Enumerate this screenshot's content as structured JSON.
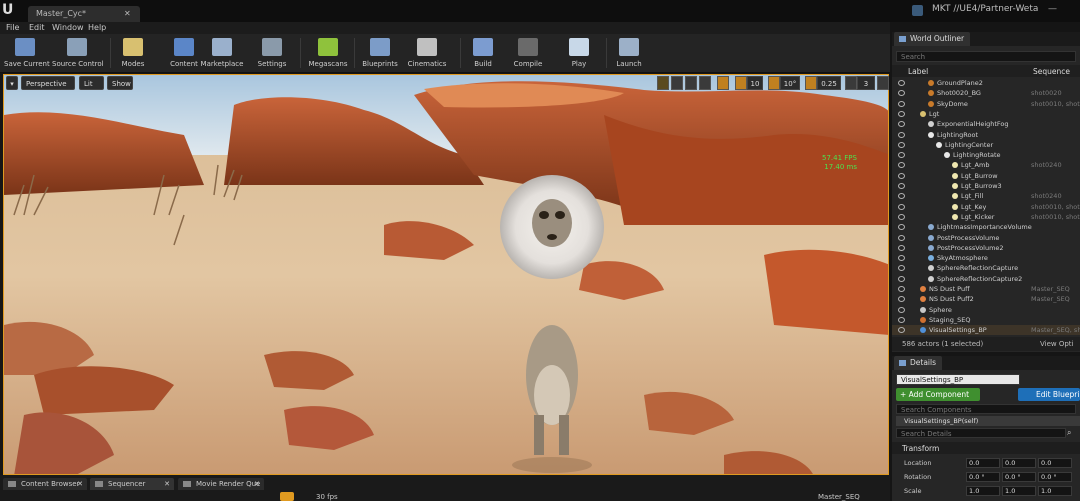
{
  "app": {
    "logo": "U",
    "document_tab": "Master_Cyc*",
    "project_title": "MKT //UE4/Partner-Weta"
  },
  "menu": [
    "File",
    "Edit",
    "Window",
    "Help"
  ],
  "toolbar": [
    {
      "label": "Save Current",
      "icon": "save-icon",
      "color": "#6b8fc4"
    },
    {
      "label": "Source Control",
      "icon": "source-control-icon",
      "color": "#8aa0b8"
    },
    {
      "label": "Modes",
      "icon": "modes-icon",
      "color": "#d8c070"
    },
    {
      "label": "Content",
      "icon": "content-icon",
      "color": "#5b86c8"
    },
    {
      "label": "Marketplace",
      "icon": "marketplace-icon",
      "color": "#9ab0cc"
    },
    {
      "label": "Settings",
      "icon": "settings-icon",
      "color": "#8a9aaa"
    },
    {
      "label": "Megascans",
      "icon": "megascans-icon",
      "color": "#8fc23c"
    },
    {
      "label": "Blueprints",
      "icon": "blueprints-icon",
      "color": "#7c9cc8"
    },
    {
      "label": "Cinematics",
      "icon": "cinematics-icon",
      "color": "#c0c0c0"
    },
    {
      "label": "Build",
      "icon": "build-icon",
      "color": "#7c9cd0"
    },
    {
      "label": "Compile",
      "icon": "compile-icon",
      "color": "#6a6a6a"
    },
    {
      "label": "Play",
      "icon": "play-icon",
      "color": "#c8d8e8"
    },
    {
      "label": "Launch",
      "icon": "launch-icon",
      "color": "#9cb0c8"
    }
  ],
  "viewport": {
    "perspective_label": "Perspective",
    "lit_label": "Lit",
    "show_label": "Show",
    "grid_snap": "10",
    "rotation_snap": "10°",
    "scale_snap": "0.25",
    "camera_speed": "3",
    "stats_fps": "57.41 FPS",
    "stats_ms": "17.40 ms"
  },
  "bottom_tabs": [
    {
      "label": "Content Browser"
    },
    {
      "label": "Sequencer"
    },
    {
      "label": "Movie Render Que"
    }
  ],
  "sequencer_toolbar": {
    "fps": "30 fps",
    "sequence_name": "Master_SEQ"
  },
  "outliner": {
    "tab_label": "World Outliner",
    "search_placeholder": "Search",
    "col_label": "Label",
    "col_sequence": "Sequence",
    "rows": [
      {
        "label": "GroundPlane2",
        "seq": "",
        "indent": 1,
        "color": "#c87a2a"
      },
      {
        "label": "Shot0020_BG",
        "seq": "shot0020",
        "indent": 1,
        "color": "#c87a2a"
      },
      {
        "label": "SkyDome",
        "seq": "shot0010, shot",
        "indent": 1,
        "color": "#c87a2a"
      },
      {
        "label": "Lgt",
        "seq": "",
        "indent": 0,
        "color": "#d8c070"
      },
      {
        "label": "ExponentialHeightFog",
        "seq": "",
        "indent": 1,
        "color": "#d0d0d0"
      },
      {
        "label": "LightingRoot",
        "seq": "",
        "indent": 1,
        "color": "#e8e8e8"
      },
      {
        "label": "LightingCenter",
        "seq": "",
        "indent": 2,
        "color": "#e8e8e8"
      },
      {
        "label": "LightingRotate",
        "seq": "",
        "indent": 3,
        "color": "#e8e8e8"
      },
      {
        "label": "Lgt_Amb",
        "seq": "shot0240",
        "indent": 4,
        "color": "#f0e8b0"
      },
      {
        "label": "Lgt_Burrow",
        "seq": "",
        "indent": 4,
        "color": "#f0e8b0"
      },
      {
        "label": "Lgt_Burrow3",
        "seq": "",
        "indent": 4,
        "color": "#f0e8b0"
      },
      {
        "label": "Lgt_Fill",
        "seq": "shot0240",
        "indent": 4,
        "color": "#f0e8b0"
      },
      {
        "label": "Lgt_Key",
        "seq": "shot0010, shot",
        "indent": 4,
        "color": "#f0e8b0"
      },
      {
        "label": "Lgt_Kicker",
        "seq": "shot0010, shot",
        "indent": 4,
        "color": "#f0e8b0"
      },
      {
        "label": "LightmassImportanceVolume",
        "seq": "",
        "indent": 1,
        "color": "#8aaad0"
      },
      {
        "label": "PostProcessVolume",
        "seq": "",
        "indent": 1,
        "color": "#8aaad0"
      },
      {
        "label": "PostProcessVolume2",
        "seq": "",
        "indent": 1,
        "color": "#8aaad0"
      },
      {
        "label": "SkyAtmosphere",
        "seq": "",
        "indent": 1,
        "color": "#7ab0e0"
      },
      {
        "label": "SphereReflectionCapture",
        "seq": "",
        "indent": 1,
        "color": "#d0d0d0"
      },
      {
        "label": "SphereReflectionCapture2",
        "seq": "",
        "indent": 1,
        "color": "#d0d0d0"
      },
      {
        "label": "NS Dust Puff",
        "seq": "Master_SEQ",
        "indent": 0,
        "color": "#e08040"
      },
      {
        "label": "NS Dust Puff2",
        "seq": "Master_SEQ",
        "indent": 0,
        "color": "#e08040"
      },
      {
        "label": "Sphere",
        "seq": "",
        "indent": 0,
        "color": "#c8c8c8"
      },
      {
        "label": "Staging_SEQ",
        "seq": "",
        "indent": 0,
        "color": "#d07030"
      },
      {
        "label": "VisualSettings_BP",
        "seq": "Master_SEQ, sh",
        "indent": 0,
        "color": "#5090d8",
        "selected": true
      }
    ],
    "footer_count": "586 actors (1 selected)",
    "view_options": "View Opti"
  },
  "details": {
    "tab_label": "Details",
    "actor_name": "VisualSettings_BP",
    "add_component": "+ Add Component",
    "edit_blueprint": "Edit Blueprint",
    "search_components": "Search Components",
    "component_self": "VisualSettings_BP(self)",
    "search_details": "Search Details",
    "transform_label": "Transform",
    "location_label": "Location",
    "rotation_label": "Rotation",
    "scale_label": "Scale",
    "location": [
      "0.0",
      "0.0",
      "0.0"
    ],
    "rotation": [
      "0.0 °",
      "0.0 °",
      "0.0 °"
    ],
    "scale": [
      "1.0",
      "1.0",
      "1.0"
    ]
  },
  "colors": {
    "accent": "#e09a20",
    "selected_row": "#3d3428",
    "add_component": "#3f8f2f",
    "edit_blueprint": "#1e6fb8"
  }
}
